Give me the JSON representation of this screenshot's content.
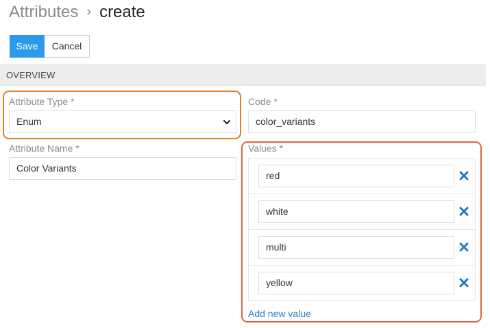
{
  "breadcrumb": {
    "root": "Attributes",
    "separator": "›",
    "current": "create"
  },
  "toolbar": {
    "save_label": "Save",
    "cancel_label": "Cancel"
  },
  "section": {
    "title": "OVERVIEW"
  },
  "form": {
    "attribute_type": {
      "label": "Attribute Type *",
      "value": "Enum"
    },
    "code": {
      "label": "Code *",
      "value": "color_variants"
    },
    "attribute_name": {
      "label": "Attribute Name *",
      "value": "Color Variants"
    },
    "values": {
      "label": "Values *",
      "items": [
        "red",
        "white",
        "multi",
        "yellow"
      ],
      "add_label": "Add new value"
    }
  },
  "colors": {
    "primary": "#2b9aea",
    "link": "#2b7fc0",
    "highlight_orange": "#e67e22",
    "highlight_red": "#e8603c",
    "remove_icon": "#1a7bc6"
  },
  "icons": {
    "select": "chevron-down-icon",
    "remove": "close-icon"
  }
}
